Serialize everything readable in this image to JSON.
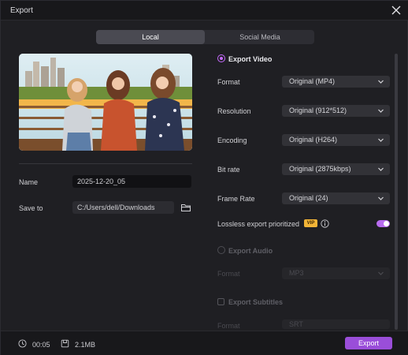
{
  "window": {
    "title": "Export"
  },
  "tabs": [
    {
      "label": "Local",
      "active": true
    },
    {
      "label": "Social Media",
      "active": false
    }
  ],
  "file": {
    "name_label": "Name",
    "name_value": "2025-12-20_05",
    "save_label": "Save to",
    "save_value": "C:/Users/dell/Downloads"
  },
  "video": {
    "heading": "Export Video",
    "format_label": "Format",
    "format_value": "Original (MP4)",
    "resolution_label": "Resolution",
    "resolution_value": "Original (912*512)",
    "encoding_label": "Encoding",
    "encoding_value": "Original (H264)",
    "bitrate_label": "Bit rate",
    "bitrate_value": "Original (2875kbps)",
    "framerate_label": "Frame Rate",
    "framerate_value": "Original (24)",
    "lossless_label": "Lossless export prioritized",
    "vip_badge": "VIP",
    "lossless_on": true
  },
  "audio": {
    "heading": "Export Audio",
    "format_label": "Format",
    "format_value": "MP3"
  },
  "subtitles": {
    "heading": "Export Subtitles",
    "format_label": "Format",
    "format_value": "SRT"
  },
  "footer": {
    "duration": "00:05",
    "size": "2.1MB",
    "export_label": "Export"
  },
  "colors": {
    "accent": "#9a4ed9",
    "toggle": "#b86cf0",
    "vip": "#f2b437"
  }
}
